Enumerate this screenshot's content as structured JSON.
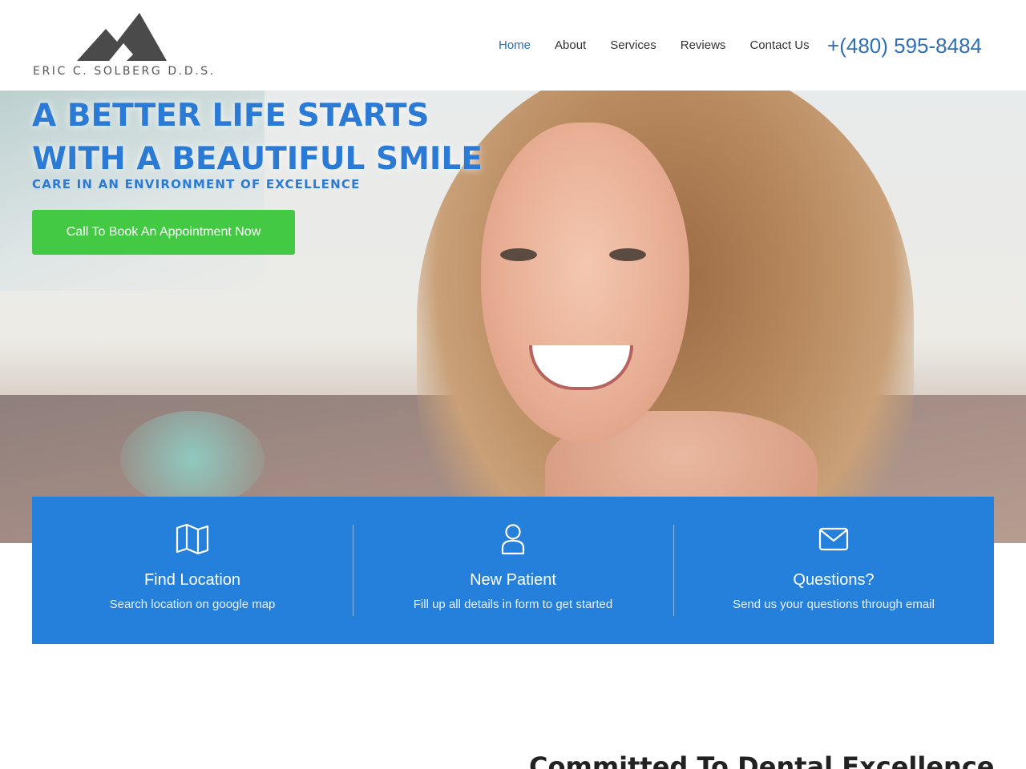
{
  "header": {
    "logo_text": "ERIC C. SOLBERG D.D.S.",
    "nav": [
      {
        "label": "Home",
        "active": true
      },
      {
        "label": "About",
        "active": false
      },
      {
        "label": "Services",
        "active": false
      },
      {
        "label": "Reviews",
        "active": false
      },
      {
        "label": "Contact Us",
        "active": false
      }
    ],
    "phone": "+(480) 595-8484"
  },
  "hero": {
    "title_line1": "A BETTER LIFE STARTS",
    "title_line2": "WITH A BEAUTIFUL SMILE",
    "subtitle": "CARE IN AN ENVIRONMENT OF EXCELLENCE",
    "cta_label": "Call To Book An Appointment Now"
  },
  "features": [
    {
      "icon": "map-icon",
      "title": "Find Location",
      "desc": "Search location on google map"
    },
    {
      "icon": "user-icon",
      "title": "New Patient",
      "desc": "Fill up all details in form to get started"
    },
    {
      "icon": "envelope-icon",
      "title": "Questions?",
      "desc": "Send us your questions through email"
    }
  ],
  "section": {
    "heading": "Committed To Dental Excellence"
  },
  "colors": {
    "brand_blue": "#2580dc",
    "link_blue": "#2f6fb3",
    "cta_green": "#44c945"
  }
}
